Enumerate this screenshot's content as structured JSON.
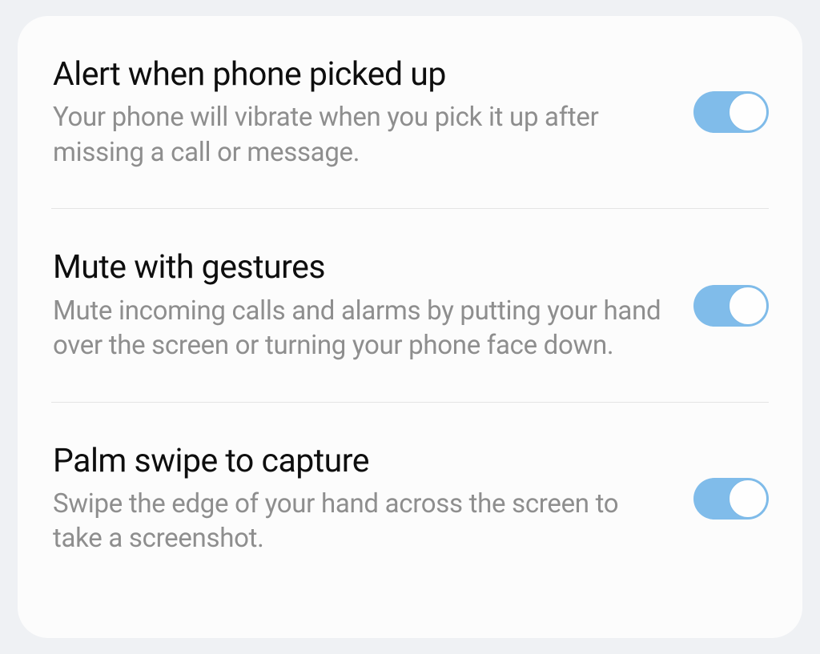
{
  "settings": [
    {
      "id": "alert-pickup",
      "title": "Alert when phone picked up",
      "description": "Your phone will vibrate when you pick it up after missing a call or message.",
      "enabled": true
    },
    {
      "id": "mute-gestures",
      "title": "Mute with gestures",
      "description": "Mute incoming calls and alarms by putting your hand over the screen or turning your phone face down.",
      "enabled": true
    },
    {
      "id": "palm-swipe",
      "title": "Palm swipe to capture",
      "description": "Swipe the edge of your hand across the screen to take a screenshot.",
      "enabled": true
    }
  ],
  "colors": {
    "toggle_on": "#80bcea",
    "toggle_thumb": "#fefefe",
    "background": "#eff1f4",
    "card": "#fcfcfc",
    "title": "#0e0e0e",
    "description": "#8e8e8e"
  }
}
